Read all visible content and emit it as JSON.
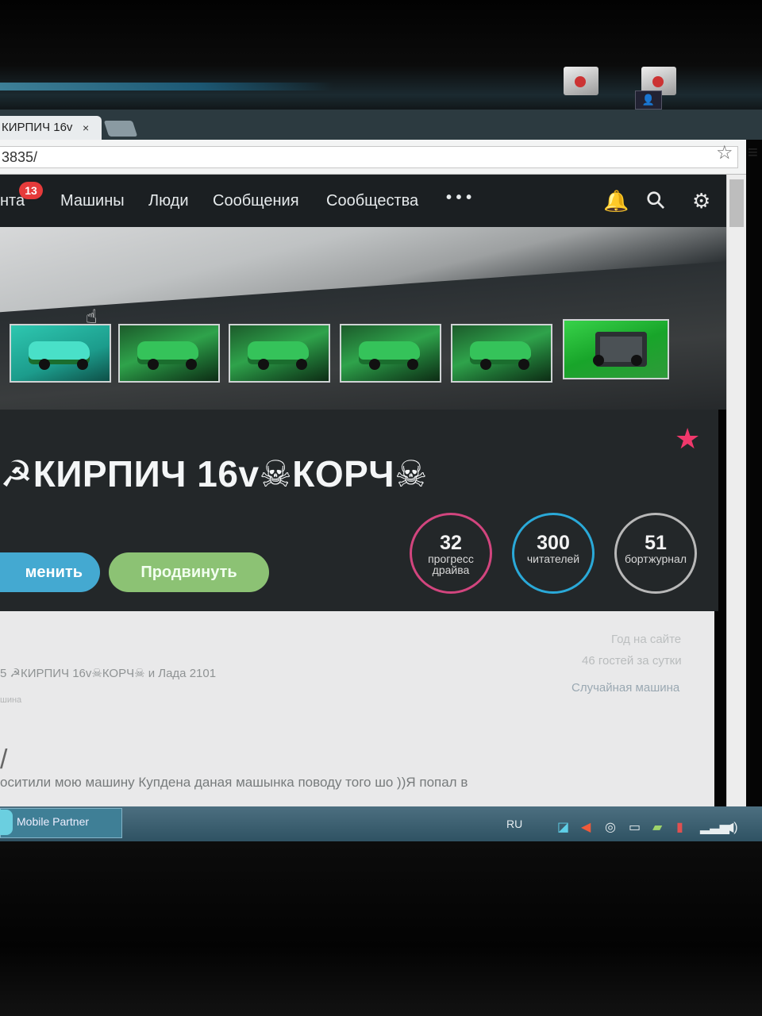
{
  "browser": {
    "tab_title": "КИРПИЧ 16v",
    "tab_close": "×",
    "url": "3835/",
    "bookmark_icon": "☆",
    "menu_icon": "≡"
  },
  "nav": {
    "items": [
      {
        "label": "нта"
      },
      {
        "label": "Машины"
      },
      {
        "label": "Люди"
      },
      {
        "label": "Сообщения"
      },
      {
        "label": "Сообщества"
      },
      {
        "label": "• • •"
      }
    ],
    "badge": "13",
    "bell_icon": "🔔",
    "search_icon": "⚲",
    "settings_icon": "⚙"
  },
  "profile": {
    "title": "☭КИРПИЧ 16v☠КОРЧ☠",
    "fav_icon": "★",
    "change_label": "менить",
    "promote_label": "Продвинуть",
    "stats": [
      {
        "value": "32",
        "label_1": "прогресс",
        "label_2": "драйва"
      },
      {
        "value": "300",
        "label_1": "читателей",
        "label_2": ""
      },
      {
        "value": "51",
        "label_1": "бортжурнал",
        "label_2": ""
      }
    ]
  },
  "content": {
    "subtitle": "5 ☭КИРПИЧ 16v☠КОРЧ☠ и Лада 2101",
    "note": "шина",
    "slash": "/",
    "post_text": "оситили мою машину Купдена даная машынка поводу того шо ))Я попал в",
    "side": {
      "year": "Год на сайте",
      "guests": "46 гостей за сутки",
      "random": "Случайная машина"
    }
  },
  "taskbar": {
    "app_label": "Mobile Partner",
    "lang": "RU",
    "tray_icons": [
      "wifi-tray",
      "volume-muted",
      "network",
      "display",
      "usb",
      "security",
      "signal",
      "volume"
    ]
  },
  "colors": {
    "nav_bg": "#1b1f22",
    "profile_bg": "#232729",
    "accent_blue": "#44a9d1",
    "accent_green": "#8cc274",
    "accent_pink": "#f0386b",
    "badge_red": "#e63b3b"
  }
}
